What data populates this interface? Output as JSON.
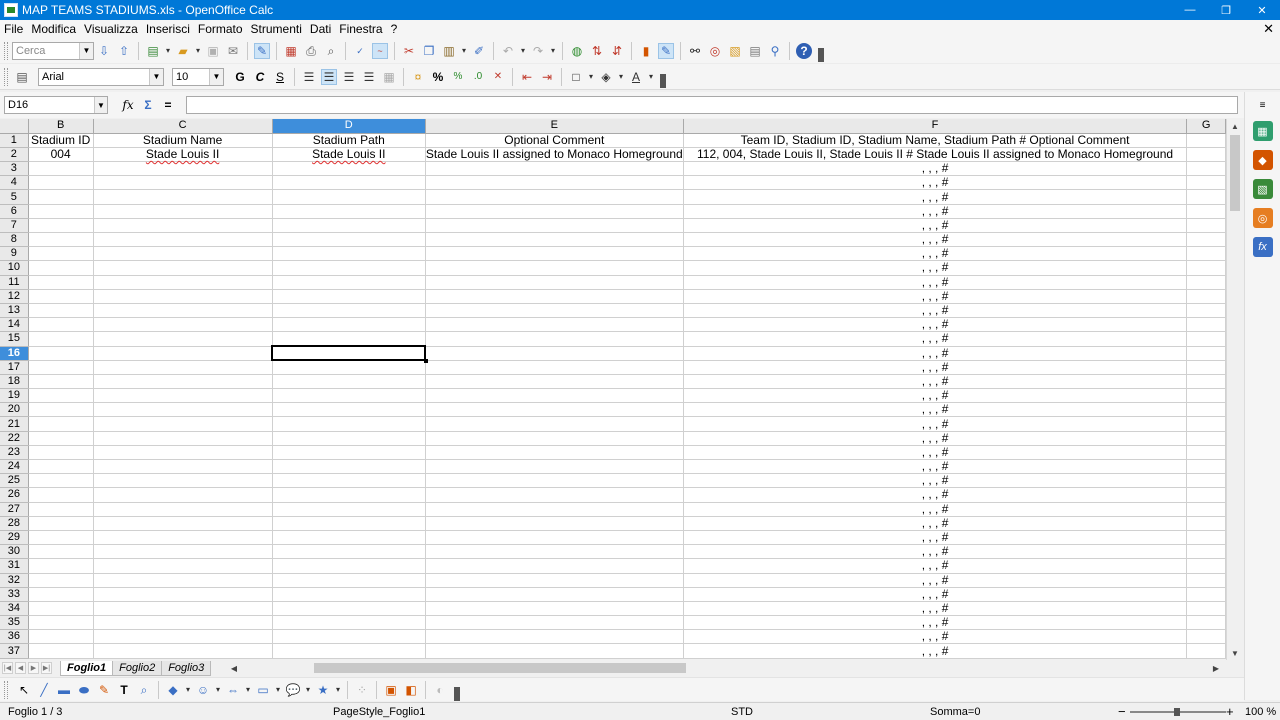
{
  "window": {
    "title": "MAP TEAMS STADIUMS.xls - OpenOffice Calc",
    "minimize": "—",
    "maximize": "❐",
    "close": "✕"
  },
  "menu": [
    "File",
    "Modifica",
    "Visualizza",
    "Inserisci",
    "Formato",
    "Strumenti",
    "Dati",
    "Finestra",
    "?"
  ],
  "menu_close": "✕",
  "toolbar": {
    "search_placeholder": "Cerca",
    "font_name": "Arial",
    "font_size": "10",
    "bold": "G",
    "italic": "C",
    "underline": "S",
    "percent": "%"
  },
  "formula_bar": {
    "cell_ref": "D16",
    "function_wizard": "fx",
    "sum": "Σ",
    "equals": "="
  },
  "sheet": {
    "columns": [
      {
        "letter": "B",
        "selected": false
      },
      {
        "letter": "C",
        "selected": false
      },
      {
        "letter": "D",
        "selected": true
      },
      {
        "letter": "E",
        "selected": false
      },
      {
        "letter": "F",
        "selected": false
      },
      {
        "letter": "G",
        "selected": false
      }
    ],
    "row1": [
      "Stadium ID",
      "Stadium Name",
      "Stadium Path",
      "Optional Comment",
      "Team ID, Stadium ID, Stadium Name, Stadium Path #  Optional Comment"
    ],
    "row2": [
      "004",
      "Stade Louis II",
      "Stade Louis II",
      "Stade Louis II assigned to Monaco Homeground",
      "112, 004, Stade Louis II, Stade Louis II #  Stade Louis II assigned to Monaco Homeground"
    ],
    "fill_value": ", , , #",
    "selected_row": 16,
    "row_count": 37
  },
  "tabs": [
    "Foglio1",
    "Foglio2",
    "Foglio3"
  ],
  "status": {
    "sheet": "Foglio 1 / 3",
    "page_style": "PageStyle_Foglio1",
    "mode": "STD",
    "sum": "Somma=0",
    "zoom": "100 %",
    "zoom_out": "−",
    "zoom_in": "+"
  },
  "colors": {
    "titlebar": "#0078d7",
    "selection": "#3e8edb"
  }
}
